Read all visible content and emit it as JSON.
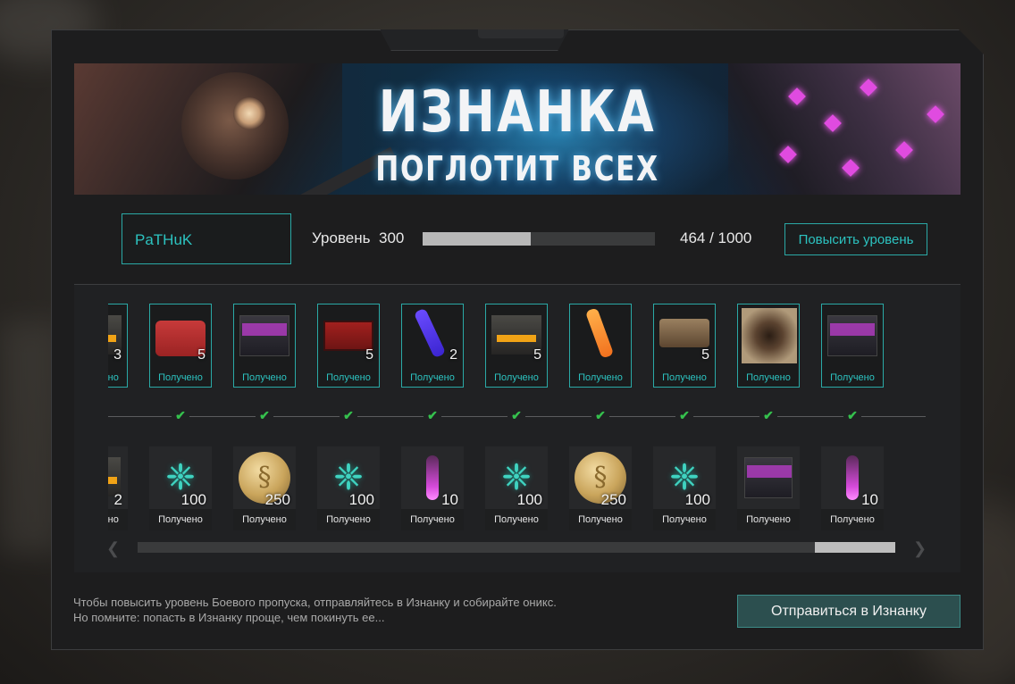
{
  "banner": {
    "title_line1": "ИЗНАНКА",
    "title_line2": "ПОГЛОТИТ ВСЕХ"
  },
  "player": {
    "name": "PaTHuK",
    "level_label": "Уровень",
    "level_value": "300",
    "xp_text": "464 / 1000",
    "xp_current": 464,
    "xp_max": 1000,
    "level_up_button": "Повысить уровень"
  },
  "premium_track": [
    {
      "item": "ammo-box-icon",
      "count": "3",
      "status": "Получено"
    },
    {
      "item": "red-case-icon",
      "count": "5",
      "status": "Получено"
    },
    {
      "item": "crate-icon",
      "count": "",
      "status": "Получено"
    },
    {
      "item": "toolbox-icon",
      "count": "5",
      "status": "Получено"
    },
    {
      "item": "glowstick-blue-icon",
      "count": "2",
      "status": "Получено"
    },
    {
      "item": "ammo-box-icon",
      "count": "5",
      "status": "Получено"
    },
    {
      "item": "glowstick-orange-icon",
      "count": "",
      "status": "Получено"
    },
    {
      "item": "detonator-icon",
      "count": "5",
      "status": "Получено"
    },
    {
      "item": "map-icon",
      "count": "",
      "status": "Получено"
    },
    {
      "item": "crate-icon",
      "count": "",
      "status": "Получено"
    }
  ],
  "free_track": [
    {
      "item": "ammo-box-icon",
      "count": "2",
      "status": "Получено"
    },
    {
      "item": "herb-icon",
      "count": "100",
      "status": "Получено"
    },
    {
      "item": "coin-icon",
      "count": "250",
      "status": "Получено"
    },
    {
      "item": "herb-icon",
      "count": "100",
      "status": "Получено"
    },
    {
      "item": "vial-icon",
      "count": "10",
      "status": "Получено"
    },
    {
      "item": "herb-icon",
      "count": "100",
      "status": "Получено"
    },
    {
      "item": "coin-icon",
      "count": "250",
      "status": "Получено"
    },
    {
      "item": "herb-icon",
      "count": "100",
      "status": "Получено"
    },
    {
      "item": "crate-icon",
      "count": "",
      "status": "Получено"
    },
    {
      "item": "vial-icon",
      "count": "10",
      "status": "Получено"
    }
  ],
  "scroll": {
    "position": 0.9
  },
  "hint": {
    "line1": "Чтобы повысить уровень Боевого пропуска, отправляйтесь в Изнанку и собирайте оникс.",
    "line2": "Но помните: попасть в Изнанку проще, чем покинуть ее..."
  },
  "go_button": "Отправиться в Изнанку",
  "colors": {
    "accent": "#2aa9a6",
    "check": "#35c04d",
    "button_bg": "#2c4f4f"
  }
}
